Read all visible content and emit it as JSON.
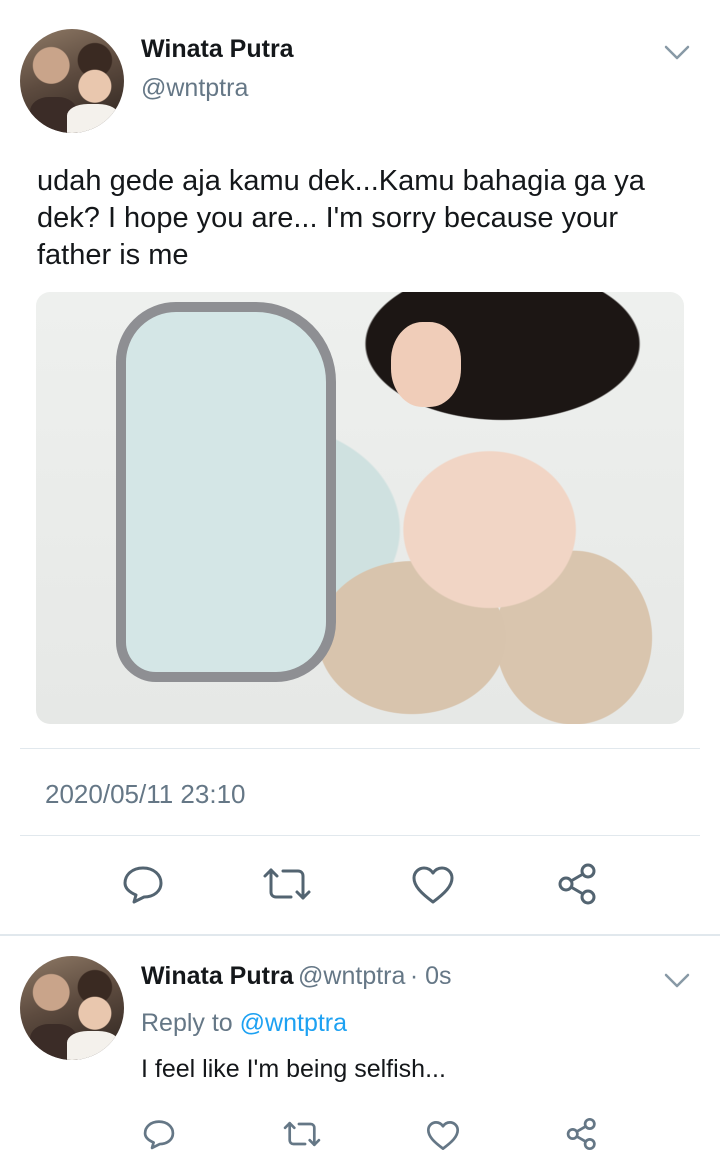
{
  "main_tweet": {
    "author_name": "Winata Putra",
    "author_handle": "@wntptra",
    "text": "udah gede aja kamu dek...Kamu bahagia ga ya dek? I hope you are... I'm sorry because your father is me",
    "timestamp": "2020/05/11 23:10"
  },
  "reply": {
    "author_name": "Winata Putra",
    "author_handle": "@wntptra",
    "time_ago": "· 0s",
    "reply_to_label": "Reply to",
    "reply_to_handle": "@wntptra",
    "text": "I feel like I'm being selfish..."
  },
  "icons": [
    "chevron-down-icon",
    "comment-icon",
    "retweet-icon",
    "like-icon",
    "share-icon"
  ],
  "colors": {
    "text": "#14171a",
    "secondary": "#657786",
    "link": "#1da1f2",
    "divider": "#e1e8ed"
  }
}
